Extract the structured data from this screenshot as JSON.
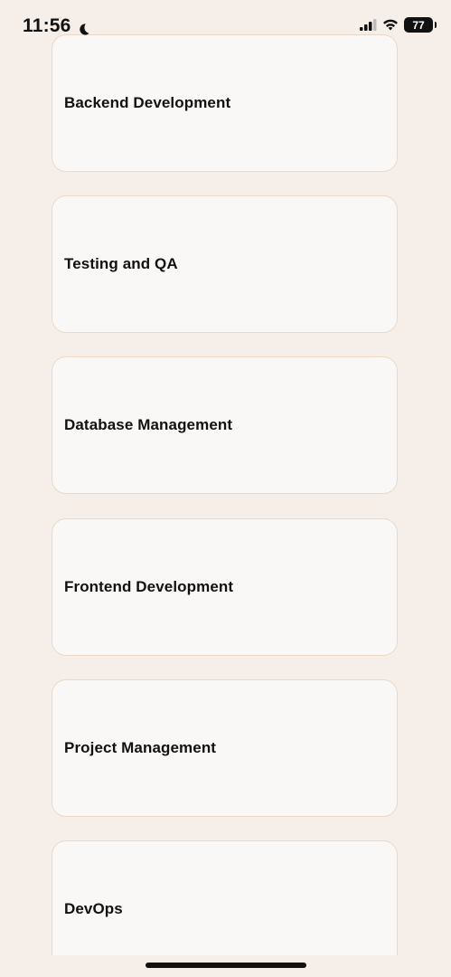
{
  "status_bar": {
    "time": "11:56",
    "battery": "77"
  },
  "categories": [
    {
      "label": "Backend Development"
    },
    {
      "label": "Testing and QA"
    },
    {
      "label": "Database Management"
    },
    {
      "label": "Frontend Development"
    },
    {
      "label": "Project Management"
    },
    {
      "label": "DevOps"
    }
  ]
}
